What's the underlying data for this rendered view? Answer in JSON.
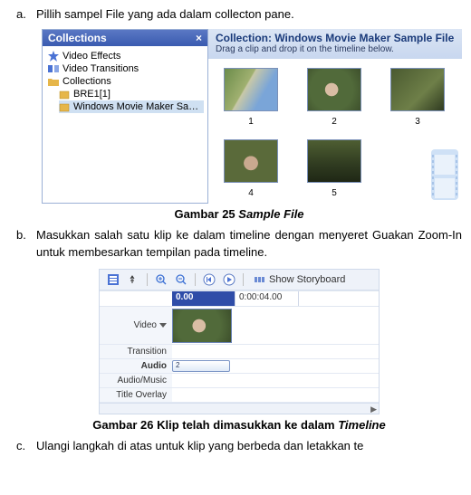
{
  "list": {
    "a": {
      "letter": "a.",
      "text": "Pillih sampel File yang ada dalam collecton pane."
    },
    "b": {
      "letter": "b.",
      "text": "Masukkan salah satu klip ke dalam timeline dengan menyeret Guakan Zoom-In untuk membesarkan tempilan pada timeline."
    },
    "c": {
      "letter": "c.",
      "text": "Ulangi langkah di atas untuk klip yang berbeda dan letakkan te"
    }
  },
  "captions": {
    "fig25": {
      "prefix": "Gambar 25 ",
      "italic": "Sample File"
    },
    "fig26": {
      "prefix": "Gambar 26 Klip telah dimasukkan ke dalam ",
      "italic": "Timeline"
    }
  },
  "collections": {
    "header": "Collections",
    "close": "×",
    "items": {
      "effects": "Video Effects",
      "transitions": "Video Transitions",
      "root": "Collections",
      "bre": "BRE1[1]",
      "sample": "Windows Movie Maker Sample File"
    }
  },
  "clips": {
    "title": "Collection: Windows Movie Maker Sample File",
    "subtitle": "Drag a clip and drop it on the timeline below.",
    "thumbs": [
      "1",
      "2",
      "3",
      "4",
      "5"
    ]
  },
  "timeline": {
    "storyboard": "Show Storyboard",
    "t0": "0.00",
    "t1": "0:00:04.00",
    "labels": {
      "video": "Video",
      "transition": "Transition",
      "audio": "Audio",
      "audiomusic": "Audio/Music",
      "title": "Title Overlay"
    },
    "audioClip": "2"
  }
}
